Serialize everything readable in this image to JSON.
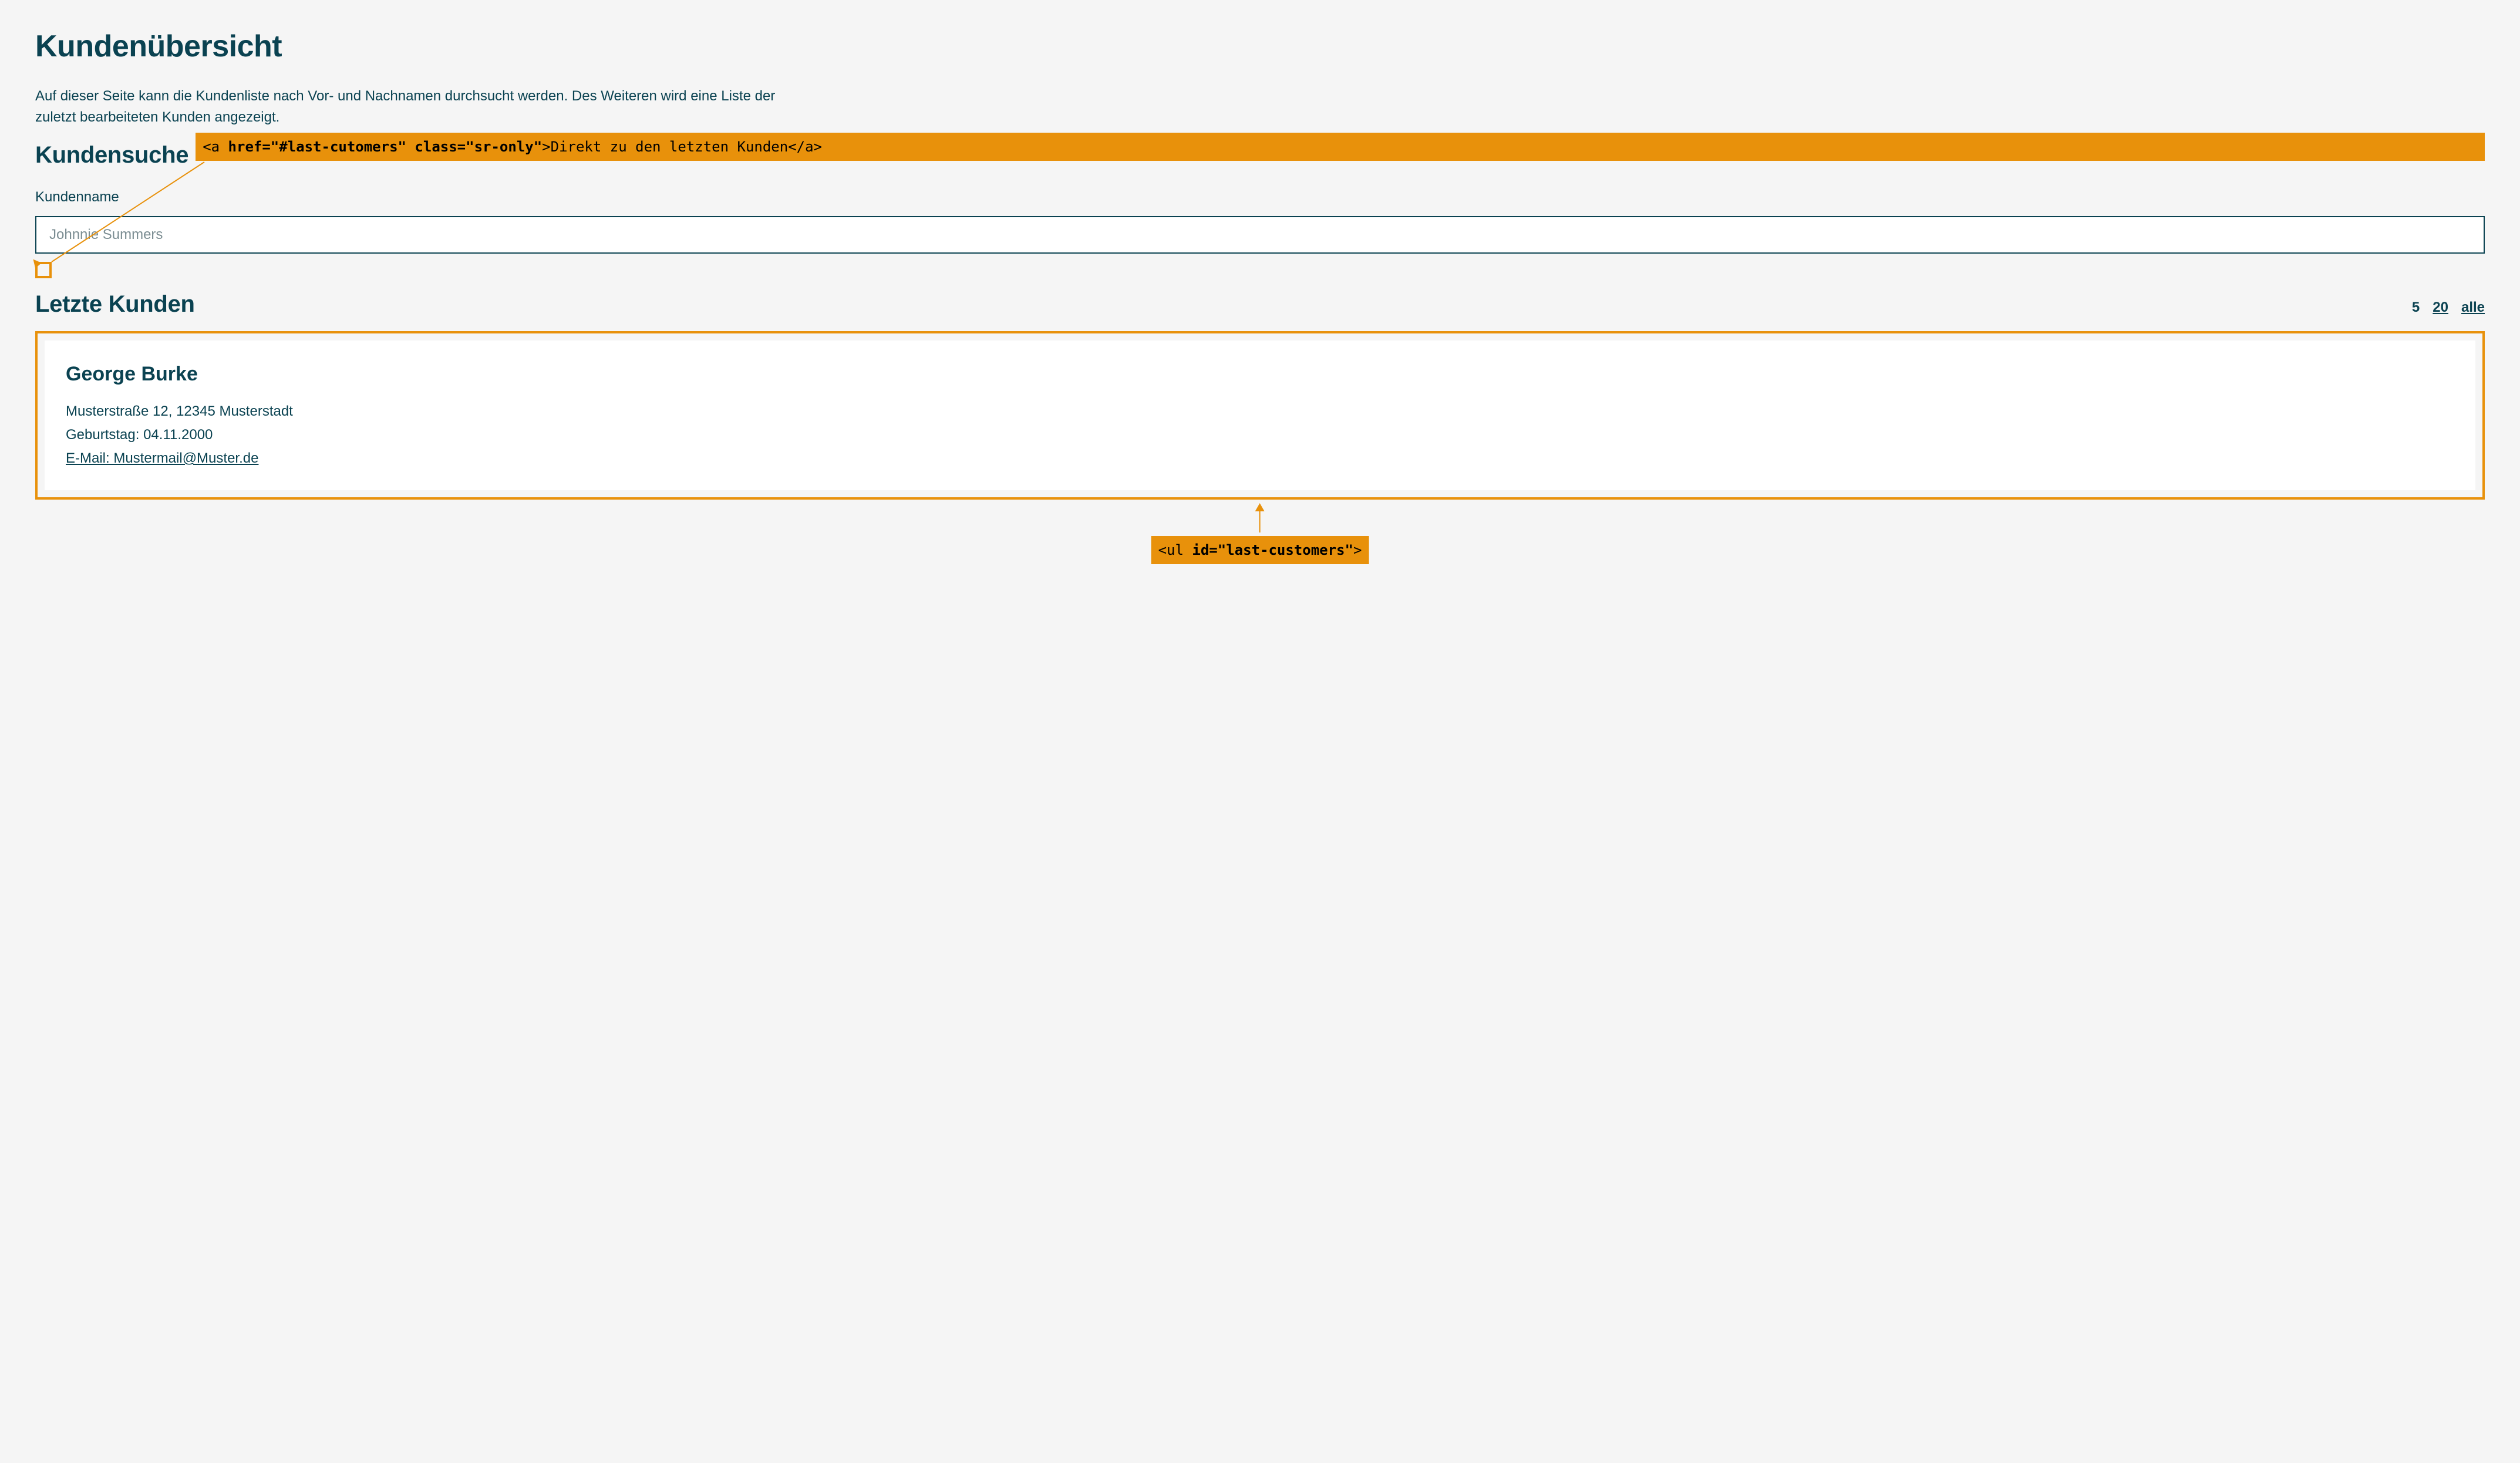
{
  "page": {
    "title": "Kundenübersicht",
    "description": "Auf dieser Seite kann die Kundenliste nach Vor- und Nachnamen durchsucht werden. Des Weiteren wird eine Liste der zuletzt bearbeiteten Kunden angezeigt."
  },
  "search": {
    "heading": "Kundensuche",
    "label": "Kundenname",
    "placeholder": "Johnnie Summers"
  },
  "annotation_top": {
    "prefix": "<a ",
    "attrs": "href=\"#last-cutomers\" class=\"sr-only\"",
    "middle": ">",
    "text": "Direkt zu den letzten Kunden",
    "suffix": "</a>"
  },
  "latest": {
    "heading": "Letzte Kunden",
    "pages": {
      "p5": "5",
      "p20": "20",
      "all": "alle"
    }
  },
  "customer": {
    "name": "George Burke",
    "address": "Musterstraße 12, 12345 Musterstadt",
    "birthday": "Geburtstag: 04.11.2000",
    "email": "E-Mail: Mustermail@Muster.de"
  },
  "annotation_bottom": {
    "prefix": "<ul ",
    "attrs": "id=\"last-customers\"",
    "suffix": ">"
  }
}
